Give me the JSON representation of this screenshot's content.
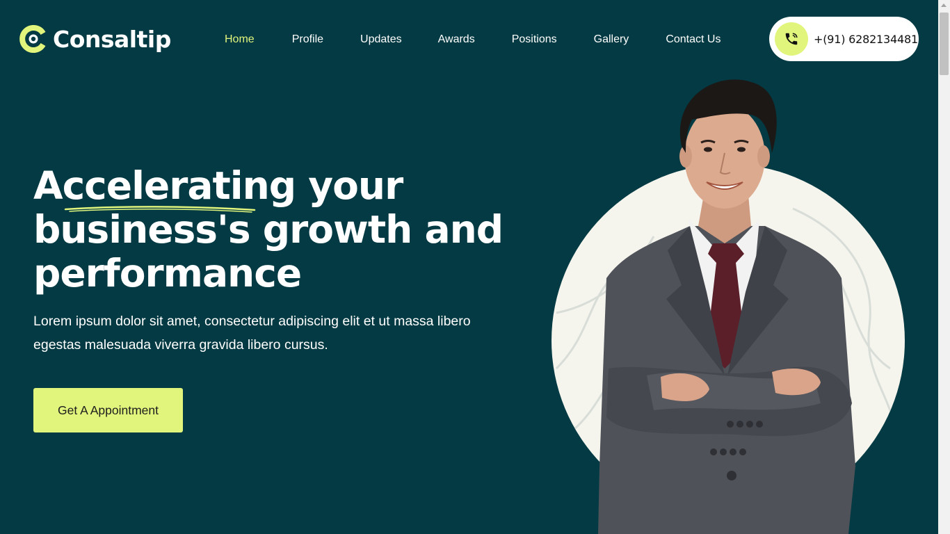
{
  "brand": {
    "name": "Consaltip",
    "accent_color": "#e1f57c",
    "background_color": "#033a43"
  },
  "nav": {
    "items": [
      {
        "label": "Home",
        "active": true
      },
      {
        "label": "Profile",
        "active": false
      },
      {
        "label": "Updates",
        "active": false
      },
      {
        "label": "Awards",
        "active": false
      },
      {
        "label": "Positions",
        "active": false
      },
      {
        "label": "Gallery",
        "active": false
      },
      {
        "label": "Contact Us",
        "active": false
      }
    ]
  },
  "contact": {
    "phone": "+(91) 6282134481",
    "icon": "phone-call-icon"
  },
  "hero": {
    "title_line1": "Accelerating your",
    "title_line2": "business's growth and",
    "title_line3": "performance",
    "description": "Lorem ipsum dolor sit amet, consectetur adipiscing elit et ut massa libero egestas malesuada viverra gravida libero cursus.",
    "cta_label": "Get A Appointment"
  }
}
